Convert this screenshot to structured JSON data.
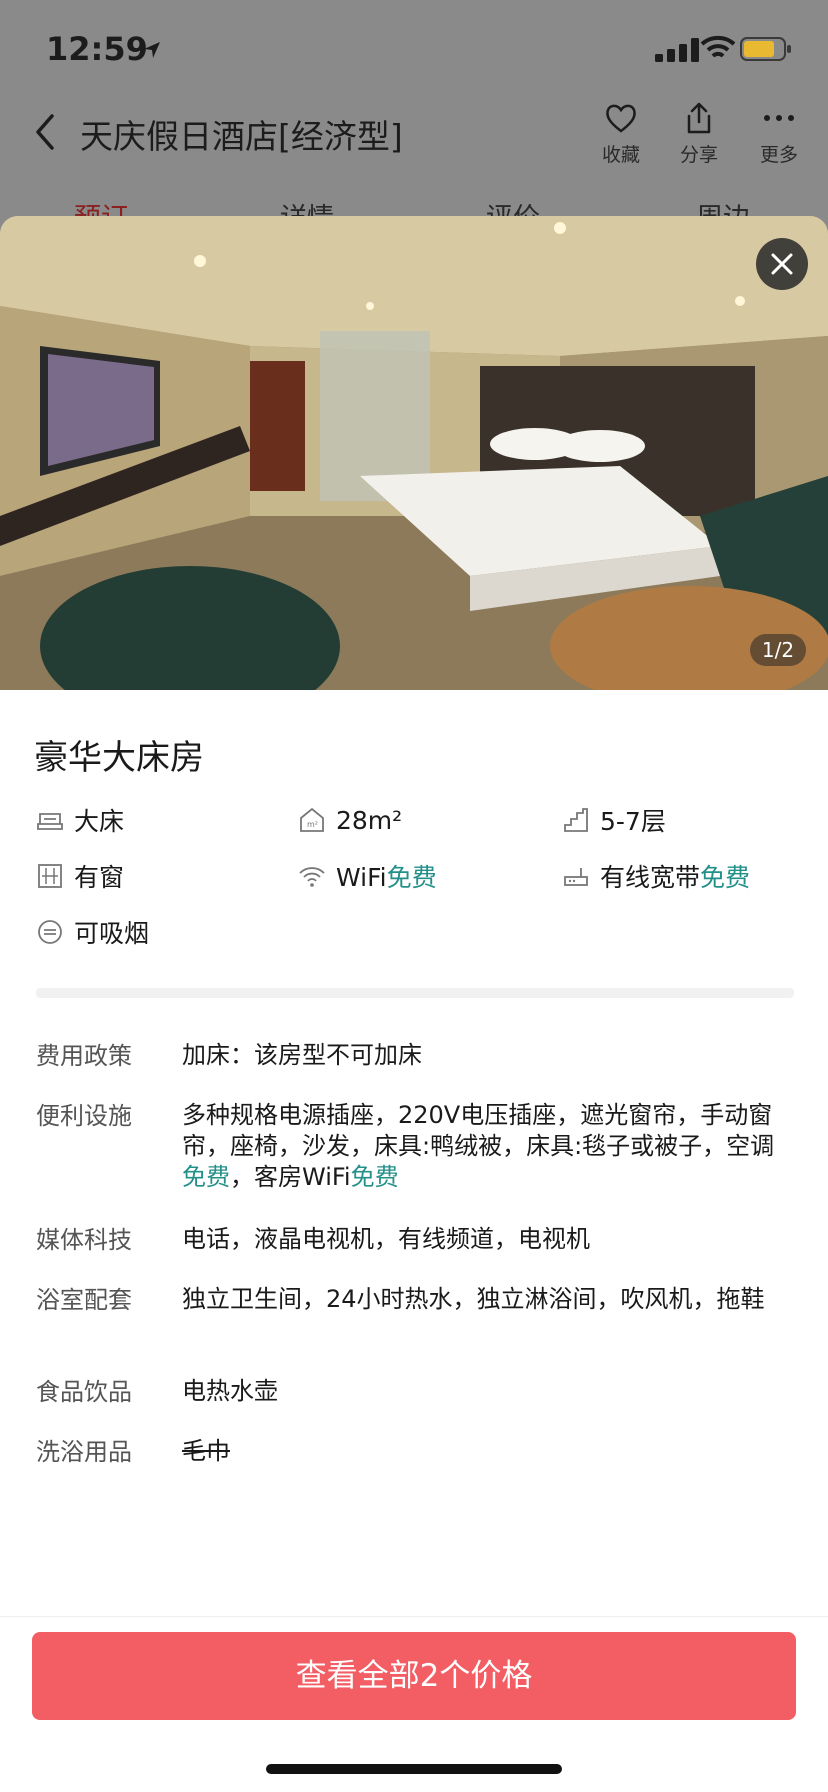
{
  "status_bar": {
    "time": "12:59"
  },
  "nav": {
    "title": "天庆假日酒店[经济型]",
    "actions": {
      "favorite": "收藏",
      "share": "分享",
      "more": "更多"
    }
  },
  "tabs": [
    "预订",
    "详情",
    "评价",
    "周边"
  ],
  "gallery": {
    "counter": "1/2"
  },
  "room": {
    "name": "豪华大床房",
    "features": {
      "bed": "大床",
      "area": "28m²",
      "floor": "5-7层",
      "window": "有窗",
      "wifi_label": "WiFi",
      "wifi_free": "免费",
      "broadband_label": "有线宽带",
      "broadband_free": "免费",
      "smoking": "可吸烟"
    }
  },
  "policies": {
    "fee": {
      "label": "费用政策",
      "value": "加床：该房型不可加床"
    },
    "amenities": {
      "label": "便利设施",
      "value_a": "多种规格电源插座，220V电压插座，遮光窗帘，手动窗帘，座椅，沙发，床具:鸭绒被，床具:毯子或被子，空调",
      "free_a": "免费",
      "value_b": "，客房WiFi",
      "free_b": "免费"
    },
    "media": {
      "label": "媒体科技",
      "value": "电话，液晶电视机，有线频道，电视机"
    },
    "bathroom": {
      "label": "浴室配套",
      "value": "独立卫生间，24小时热水，独立淋浴间，吹风机，拖鞋"
    },
    "food": {
      "label": "食品饮品",
      "value": "电热水壶"
    },
    "toiletries": {
      "label": "洗浴用品",
      "value": "毛巾"
    }
  },
  "cta": {
    "label": "查看全部2个价格"
  },
  "colors": {
    "accent": "#f25e63",
    "free_green": "#23908a"
  }
}
